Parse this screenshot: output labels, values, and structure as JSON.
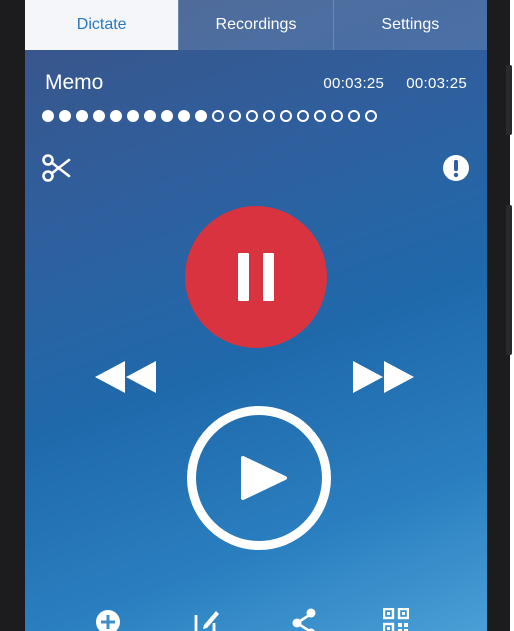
{
  "tabs": [
    {
      "label": "Dictate",
      "active": true
    },
    {
      "label": "Recordings",
      "active": false
    },
    {
      "label": "Settings",
      "active": false
    }
  ],
  "recording": {
    "title": "Memo",
    "time_position": "00:03:25",
    "time_length": "00:03:25",
    "progress_dots_total": 20,
    "progress_dots_filled": 10
  },
  "icons": {
    "cut": "scissors-icon",
    "alert": "exclamation-icon",
    "pause": "pause-icon",
    "rewind": "rewind-icon",
    "fast_forward": "fast-forward-icon",
    "play": "play-icon",
    "add": "plus-circle-icon",
    "edit": "edit-icon",
    "share": "share-icon",
    "qr": "qr-code-icon"
  },
  "colors": {
    "record_red": "#d8333f",
    "active_tab_text": "#2a78bd",
    "active_tab_bg": "#f4f6f9",
    "foreground": "#ffffff"
  }
}
